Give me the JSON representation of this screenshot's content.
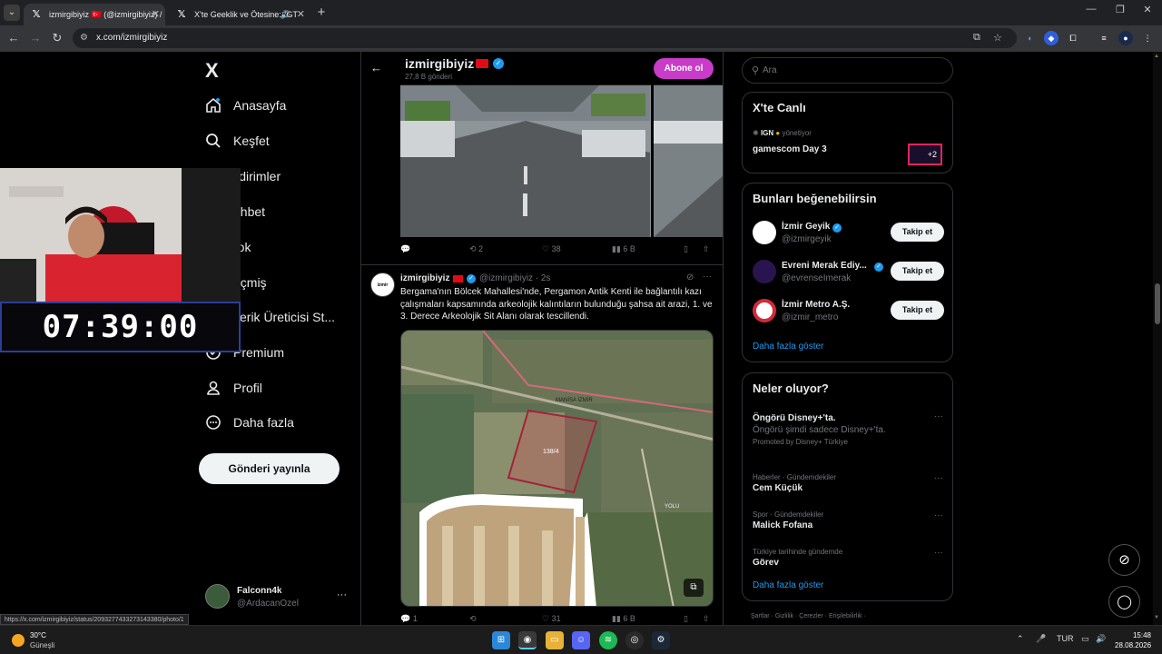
{
  "browser": {
    "tabs": [
      {
        "title": "izmirgibiyiz 🇹🇷 (@izmirgibiyiz) /",
        "active": true
      },
      {
        "title": "X'te Geeklik ve Ötesine: \"GT",
        "active": false
      }
    ],
    "url": "x.com/izmirgibiyiz",
    "status_url": "https://x.com/izmirgibiyiz/status/2093277433273143380/photo/1"
  },
  "nav": {
    "logo": "X",
    "items": [
      {
        "label": "Anasayfa",
        "icon": "home-icon"
      },
      {
        "label": "Keşfet",
        "icon": "search-icon"
      },
      {
        "label": "ildirimler",
        "icon": "bell-icon"
      },
      {
        "label": "ohbet",
        "icon": "mail-icon"
      },
      {
        "label": "rok",
        "icon": "grok-icon"
      },
      {
        "label": "eçmiş",
        "icon": "history-icon"
      },
      {
        "label": "çerik Üreticisi St...",
        "icon": "studio-icon"
      },
      {
        "label": "Premium",
        "icon": "premium-icon"
      },
      {
        "label": "Profil",
        "icon": "profile-icon"
      },
      {
        "label": "Daha fazla",
        "icon": "more-icon"
      }
    ],
    "post_button": "Gönderi yayınla",
    "account": {
      "name": "Falconn4k",
      "handle": "@ArdacanOzel",
      "more": "···"
    }
  },
  "overlay": {
    "timer": "07:39:00"
  },
  "profile": {
    "name": "izmirgibiyiz",
    "post_count": "27,8 B gönderi",
    "subscribe": "Abone ol"
  },
  "tweet1_actions": {
    "reply": "",
    "retweet": "2",
    "like": "38",
    "views": "6 B"
  },
  "tweet2": {
    "name": "izmirgibiyiz",
    "handle_time": "@izmirgibiyiz · 2s",
    "text": "Bergama'nın Bölcek Mahallesi'nde, Pergamon Antik Kenti ile bağlantılı kazı çalışmaları kapsamında arkeolojik kalıntıların bulunduğu şahsa ait arazi, 1. ve 3. Derece Arkeolojik Sit Alanı olarak tescillendi.",
    "map_labels": {
      "border": "MANİSA İZMİR",
      "parcel": "138/4",
      "road": "YOLU"
    },
    "actions": {
      "reply": "1",
      "retweet": "",
      "like": "31",
      "views": "6 B"
    }
  },
  "right": {
    "search_placeholder": "Ara",
    "live": {
      "title": "X'te Canlı",
      "host": "IGN",
      "host_suffix": "yönetiyor",
      "event": "gamescom Day 3",
      "badge": "+2"
    },
    "suggestions": {
      "title": "Bunları beğenebilirsin",
      "follow": "Takip et",
      "items": [
        {
          "name": "İzmir Geyik",
          "handle": "@izmirgeyik",
          "color": "#ffffff"
        },
        {
          "name": "Evreni Merak Ediy...",
          "handle": "@evrenseImerak",
          "color": "#2a1450"
        },
        {
          "name": "İzmir Metro A.Ş.",
          "handle": "@izmir_metro",
          "color": "#ffffff"
        }
      ],
      "show_more": "Daha fazla göster"
    },
    "trends": {
      "title": "Neler oluyor?",
      "items": [
        {
          "meta": "",
          "title": "Öngörü Disney+'ta.",
          "sub": "Öngörü şimdi sadece Disney+'ta.",
          "promo": "Promoted by Disney+ Türkiye"
        },
        {
          "meta": "Haberler · Gündemdekiler",
          "title": "Cem Küçük",
          "sub": "",
          "promo": ""
        },
        {
          "meta": "Spor · Gündemdekiler",
          "title": "Malick Fofana",
          "sub": "",
          "promo": ""
        },
        {
          "meta": "Türkiye tarihinde gündemde",
          "title": "Görev",
          "sub": "",
          "promo": ""
        }
      ],
      "show_more": "Daha fazla göster"
    },
    "footer": "Şartlar  ·  Gizlilik  ·  Çerezler  ·  Erişilebilirlik  ·"
  },
  "taskbar": {
    "temp": "30°C",
    "condition": "Güneşli",
    "lang": "TUR",
    "time": "15:48",
    "date": "28.08.2026"
  }
}
